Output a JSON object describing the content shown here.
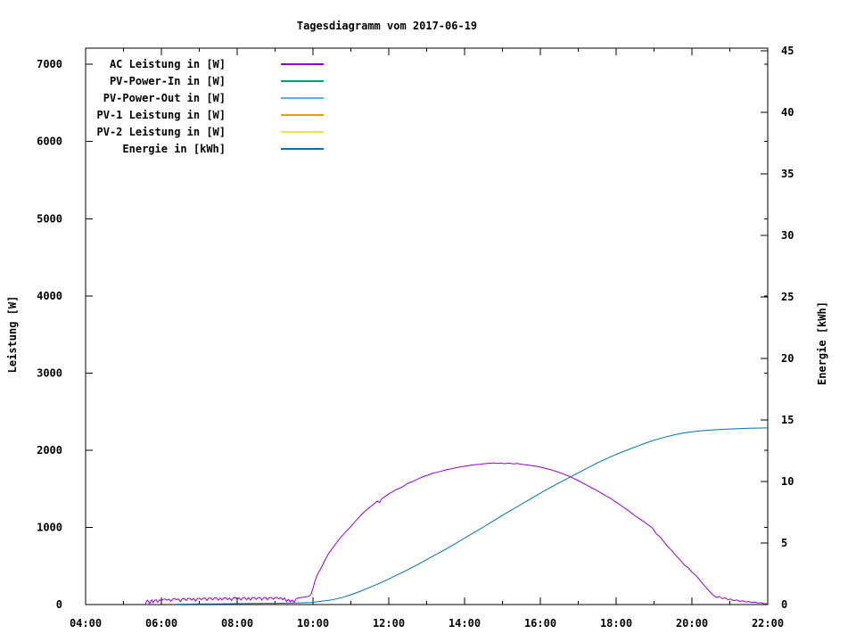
{
  "page": {
    "background_color": "#ffffff",
    "axis_color": "#000000",
    "text_color": "#000000"
  },
  "chart_data": {
    "type": "line",
    "title": "Tagesdiagramm vom 2017-06-19",
    "ylabel_left": "Leistung [W]",
    "ylabel_right": "Energie [kWh]",
    "grid": false,
    "legend_position": "top-left-inside",
    "x_axis": {
      "unit": "time-of-day",
      "start_hour": 4,
      "end_hour": 22,
      "major_ticks": [
        {
          "hour": 4,
          "label": "04:00"
        },
        {
          "hour": 6,
          "label": "06:00"
        },
        {
          "hour": 8,
          "label": "08:00"
        },
        {
          "hour": 10,
          "label": "10:00"
        },
        {
          "hour": 12,
          "label": "12:00"
        },
        {
          "hour": 14,
          "label": "14:00"
        },
        {
          "hour": 16,
          "label": "16:00"
        },
        {
          "hour": 18,
          "label": "18:00"
        },
        {
          "hour": 20,
          "label": "20:00"
        },
        {
          "hour": 22,
          "label": "22:00"
        }
      ],
      "minor_tick_hours": [
        5,
        7,
        9,
        11,
        13,
        15,
        17,
        19,
        21
      ]
    },
    "y_left": {
      "min": 0,
      "max": 7210,
      "tick_values": [
        0,
        1000,
        2000,
        3000,
        4000,
        5000,
        6000,
        7000
      ]
    },
    "y_right": {
      "min": 0,
      "max": 45.2,
      "tick_values": [
        0,
        5,
        10,
        15,
        20,
        25,
        30,
        35,
        40,
        45
      ]
    },
    "series": [
      {
        "name": "AC Leistung in [W]",
        "color": "#9400D3",
        "axis": "left",
        "points": [
          [
            5.58,
            0
          ],
          [
            5.6,
            35
          ],
          [
            5.63,
            55
          ],
          [
            5.66,
            40
          ],
          [
            5.69,
            10
          ],
          [
            5.72,
            45
          ],
          [
            5.75,
            60
          ],
          [
            5.78,
            25
          ],
          [
            5.82,
            55
          ],
          [
            5.86,
            62
          ],
          [
            5.9,
            30
          ],
          [
            5.95,
            60
          ],
          [
            6.0,
            48
          ],
          [
            6.05,
            68
          ],
          [
            6.1,
            72
          ],
          [
            6.15,
            55
          ],
          [
            6.2,
            70
          ],
          [
            6.25,
            42
          ],
          [
            6.3,
            72
          ],
          [
            6.35,
            78
          ],
          [
            6.4,
            60
          ],
          [
            6.45,
            74
          ],
          [
            6.5,
            38
          ],
          [
            6.55,
            74
          ],
          [
            6.6,
            80
          ],
          [
            6.65,
            52
          ],
          [
            6.7,
            78
          ],
          [
            6.75,
            82
          ],
          [
            6.8,
            58
          ],
          [
            6.85,
            80
          ],
          [
            6.9,
            44
          ],
          [
            6.95,
            78
          ],
          [
            7.0,
            82
          ],
          [
            7.05,
            62
          ],
          [
            7.1,
            80
          ],
          [
            7.15,
            85
          ],
          [
            7.2,
            52
          ],
          [
            7.25,
            82
          ],
          [
            7.3,
            86
          ],
          [
            7.35,
            60
          ],
          [
            7.4,
            84
          ],
          [
            7.45,
            88
          ],
          [
            7.5,
            55
          ],
          [
            7.55,
            85
          ],
          [
            7.6,
            58
          ],
          [
            7.65,
            86
          ],
          [
            7.7,
            88
          ],
          [
            7.75,
            62
          ],
          [
            7.8,
            86
          ],
          [
            7.85,
            52
          ],
          [
            7.9,
            86
          ],
          [
            7.95,
            90
          ],
          [
            8.0,
            68
          ],
          [
            8.05,
            88
          ],
          [
            8.1,
            58
          ],
          [
            8.15,
            88
          ],
          [
            8.2,
            92
          ],
          [
            8.25,
            62
          ],
          [
            8.3,
            88
          ],
          [
            8.35,
            56
          ],
          [
            8.4,
            90
          ],
          [
            8.45,
            92
          ],
          [
            8.5,
            66
          ],
          [
            8.55,
            90
          ],
          [
            8.6,
            92
          ],
          [
            8.65,
            58
          ],
          [
            8.7,
            90
          ],
          [
            8.75,
            92
          ],
          [
            8.8,
            62
          ],
          [
            8.85,
            90
          ],
          [
            8.9,
            92
          ],
          [
            8.95,
            68
          ],
          [
            9.0,
            90
          ],
          [
            9.05,
            92
          ],
          [
            9.1,
            72
          ],
          [
            9.15,
            90
          ],
          [
            9.2,
            62
          ],
          [
            9.25,
            86
          ],
          [
            9.3,
            38
          ],
          [
            9.35,
            68
          ],
          [
            9.4,
            34
          ],
          [
            9.45,
            58
          ],
          [
            9.5,
            30
          ],
          [
            9.55,
            72
          ],
          [
            9.6,
            84
          ],
          [
            9.65,
            88
          ],
          [
            9.7,
            92
          ],
          [
            9.75,
            95
          ],
          [
            9.8,
            98
          ],
          [
            9.85,
            102
          ],
          [
            9.9,
            112
          ],
          [
            9.95,
            135
          ],
          [
            10.0,
            210
          ],
          [
            10.05,
            300
          ],
          [
            10.1,
            370
          ],
          [
            10.15,
            420
          ],
          [
            10.22,
            480
          ],
          [
            10.3,
            560
          ],
          [
            10.4,
            650
          ],
          [
            10.53,
            740
          ],
          [
            10.65,
            820
          ],
          [
            10.75,
            880
          ],
          [
            10.86,
            940
          ],
          [
            11.0,
            1010
          ],
          [
            11.08,
            1060
          ],
          [
            11.16,
            1100
          ],
          [
            11.25,
            1150
          ],
          [
            11.33,
            1190
          ],
          [
            11.4,
            1220
          ],
          [
            11.47,
            1250
          ],
          [
            11.55,
            1280
          ],
          [
            11.62,
            1310
          ],
          [
            11.7,
            1340
          ],
          [
            11.76,
            1320
          ],
          [
            11.8,
            1365
          ],
          [
            11.9,
            1400
          ],
          [
            12.0,
            1435
          ],
          [
            12.1,
            1460
          ],
          [
            12.2,
            1490
          ],
          [
            12.3,
            1510
          ],
          [
            12.41,
            1540
          ],
          [
            12.5,
            1570
          ],
          [
            12.6,
            1590
          ],
          [
            12.74,
            1620
          ],
          [
            12.85,
            1645
          ],
          [
            12.95,
            1665
          ],
          [
            13.05,
            1680
          ],
          [
            13.15,
            1700
          ],
          [
            13.25,
            1712
          ],
          [
            13.36,
            1725
          ],
          [
            13.47,
            1740
          ],
          [
            13.57,
            1752
          ],
          [
            13.68,
            1762
          ],
          [
            13.8,
            1775
          ],
          [
            13.9,
            1785
          ],
          [
            13.99,
            1792
          ],
          [
            14.1,
            1800
          ],
          [
            14.2,
            1808
          ],
          [
            14.3,
            1814
          ],
          [
            14.39,
            1818
          ],
          [
            14.5,
            1824
          ],
          [
            14.6,
            1828
          ],
          [
            14.7,
            1832
          ],
          [
            14.77,
            1836
          ],
          [
            14.85,
            1828
          ],
          [
            14.95,
            1834
          ],
          [
            15.05,
            1826
          ],
          [
            15.17,
            1832
          ],
          [
            15.3,
            1822
          ],
          [
            15.4,
            1828
          ],
          [
            15.5,
            1818
          ],
          [
            15.57,
            1814
          ],
          [
            15.7,
            1806
          ],
          [
            15.8,
            1798
          ],
          [
            15.95,
            1788
          ],
          [
            16.05,
            1775
          ],
          [
            16.15,
            1762
          ],
          [
            16.25,
            1750
          ],
          [
            16.35,
            1736
          ],
          [
            16.45,
            1720
          ],
          [
            16.55,
            1702
          ],
          [
            16.65,
            1684
          ],
          [
            16.75,
            1664
          ],
          [
            16.85,
            1642
          ],
          [
            16.95,
            1618
          ],
          [
            17.05,
            1594
          ],
          [
            17.13,
            1570
          ],
          [
            17.25,
            1540
          ],
          [
            17.35,
            1514
          ],
          [
            17.45,
            1488
          ],
          [
            17.53,
            1466
          ],
          [
            17.65,
            1432
          ],
          [
            17.75,
            1404
          ],
          [
            17.85,
            1376
          ],
          [
            17.92,
            1352
          ],
          [
            18.05,
            1310
          ],
          [
            18.15,
            1276
          ],
          [
            18.3,
            1226
          ],
          [
            18.4,
            1188
          ],
          [
            18.5,
            1150
          ],
          [
            18.6,
            1116
          ],
          [
            18.7,
            1084
          ],
          [
            18.8,
            1048
          ],
          [
            18.94,
            1000
          ],
          [
            19.0,
            962
          ],
          [
            19.05,
            922
          ],
          [
            19.17,
            870
          ],
          [
            19.28,
            800
          ],
          [
            19.38,
            744
          ],
          [
            19.48,
            695
          ],
          [
            19.58,
            634
          ],
          [
            19.7,
            570
          ],
          [
            19.81,
            510
          ],
          [
            19.9,
            480
          ],
          [
            20.0,
            420
          ],
          [
            20.12,
            370
          ],
          [
            20.22,
            310
          ],
          [
            20.32,
            250
          ],
          [
            20.42,
            195
          ],
          [
            20.5,
            150
          ],
          [
            20.58,
            115
          ],
          [
            20.65,
            90
          ],
          [
            20.72,
            105
          ],
          [
            20.8,
            75
          ],
          [
            20.88,
            88
          ],
          [
            20.95,
            62
          ],
          [
            21.02,
            72
          ],
          [
            21.1,
            50
          ],
          [
            21.18,
            60
          ],
          [
            21.26,
            40
          ],
          [
            21.34,
            48
          ],
          [
            21.42,
            32
          ],
          [
            21.5,
            40
          ],
          [
            21.58,
            25
          ],
          [
            21.66,
            32
          ],
          [
            21.74,
            18
          ],
          [
            21.82,
            24
          ],
          [
            21.9,
            12
          ],
          [
            22.0,
            8
          ]
        ]
      },
      {
        "name": "PV-Power-In in [W]",
        "color": "#009E73",
        "axis": "left",
        "points": []
      },
      {
        "name": "PV-Power-Out in [W]",
        "color": "#56B4E9",
        "axis": "left",
        "points": []
      },
      {
        "name": "PV-1 Leistung in [W]",
        "color": "#E69F00",
        "axis": "left",
        "points": []
      },
      {
        "name": "PV-2 Leistung in [W]",
        "color": "#F0E442",
        "axis": "left",
        "points": []
      },
      {
        "name": "Energie in [kWh]",
        "color": "#0072B2",
        "axis": "right",
        "points": [
          [
            6.4,
            0.03
          ],
          [
            7.0,
            0.05
          ],
          [
            7.5,
            0.06
          ],
          [
            8.0,
            0.08
          ],
          [
            8.5,
            0.09
          ],
          [
            9.0,
            0.1
          ],
          [
            9.5,
            0.12
          ],
          [
            9.94,
            0.16
          ],
          [
            10.2,
            0.26
          ],
          [
            10.5,
            0.38
          ],
          [
            10.75,
            0.56
          ],
          [
            11.0,
            0.8
          ],
          [
            11.25,
            1.08
          ],
          [
            11.5,
            1.4
          ],
          [
            11.75,
            1.72
          ],
          [
            12.0,
            2.08
          ],
          [
            12.25,
            2.45
          ],
          [
            12.5,
            2.83
          ],
          [
            12.75,
            3.23
          ],
          [
            13.0,
            3.65
          ],
          [
            13.25,
            4.07
          ],
          [
            13.5,
            4.5
          ],
          [
            13.75,
            4.94
          ],
          [
            14.0,
            5.4
          ],
          [
            14.25,
            5.85
          ],
          [
            14.5,
            6.3
          ],
          [
            14.75,
            6.78
          ],
          [
            15.0,
            7.25
          ],
          [
            15.25,
            7.7
          ],
          [
            15.5,
            8.15
          ],
          [
            15.75,
            8.6
          ],
          [
            16.0,
            9.05
          ],
          [
            16.25,
            9.48
          ],
          [
            16.5,
            9.9
          ],
          [
            16.75,
            10.3
          ],
          [
            17.0,
            10.7
          ],
          [
            17.25,
            11.1
          ],
          [
            17.5,
            11.5
          ],
          [
            17.75,
            11.86
          ],
          [
            18.0,
            12.2
          ],
          [
            18.25,
            12.5
          ],
          [
            18.5,
            12.8
          ],
          [
            18.75,
            13.08
          ],
          [
            19.0,
            13.35
          ],
          [
            19.25,
            13.57
          ],
          [
            19.5,
            13.76
          ],
          [
            19.75,
            13.92
          ],
          [
            20.0,
            14.04
          ],
          [
            20.25,
            14.12
          ],
          [
            20.5,
            14.18
          ],
          [
            20.75,
            14.23
          ],
          [
            21.0,
            14.26
          ],
          [
            21.25,
            14.29
          ],
          [
            21.5,
            14.32
          ],
          [
            22.0,
            14.35
          ]
        ]
      }
    ]
  }
}
